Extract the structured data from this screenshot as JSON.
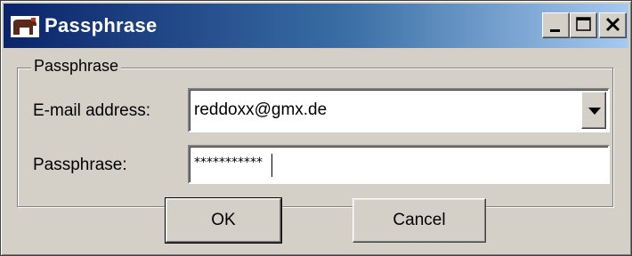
{
  "window": {
    "title": "Passphrase",
    "icon": "horse-app-icon",
    "controls": {
      "minimize": "minimize-icon",
      "maximize": "maximize-icon",
      "close": "close-icon"
    }
  },
  "group": {
    "legend": "Passphrase",
    "email": {
      "label": "E-mail address:",
      "value": "reddoxx@gmx.de"
    },
    "passphrase": {
      "label": "Passphrase:",
      "value": "***********"
    }
  },
  "buttons": {
    "ok": "OK",
    "cancel": "Cancel"
  },
  "colors": {
    "titlebar_start": "#0a246a",
    "titlebar_end": "#a6caf0",
    "face": "#d4d0c8"
  }
}
